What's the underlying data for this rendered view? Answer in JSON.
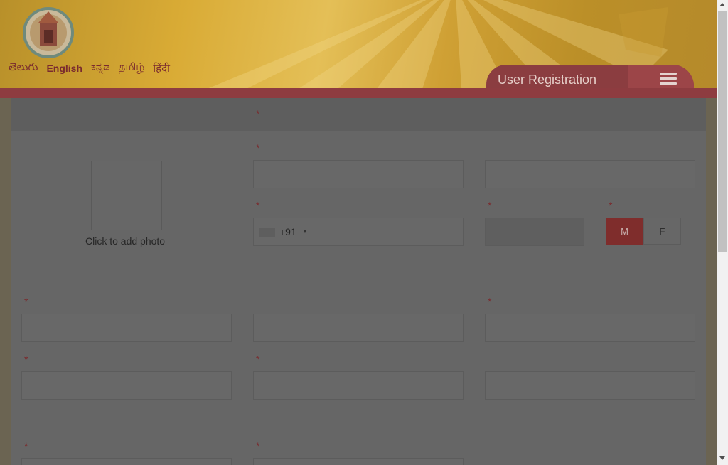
{
  "header": {
    "languages": [
      "తెలుగు",
      "English",
      "ಕನ್ನಡ",
      "தமிழ்",
      "हिंदी"
    ],
    "active_language": "English",
    "page_title": "User Registration"
  },
  "form": {
    "required_mark": "*",
    "photo_label": "Click to add photo",
    "phone_country_code": "+91",
    "gender_options": [
      "M",
      "F"
    ],
    "gender_selected": "M"
  },
  "colors": {
    "brand_maroon": "#8e3c40",
    "header_gold": "#d9ab35",
    "selected_gender": "#7f2d2c"
  }
}
